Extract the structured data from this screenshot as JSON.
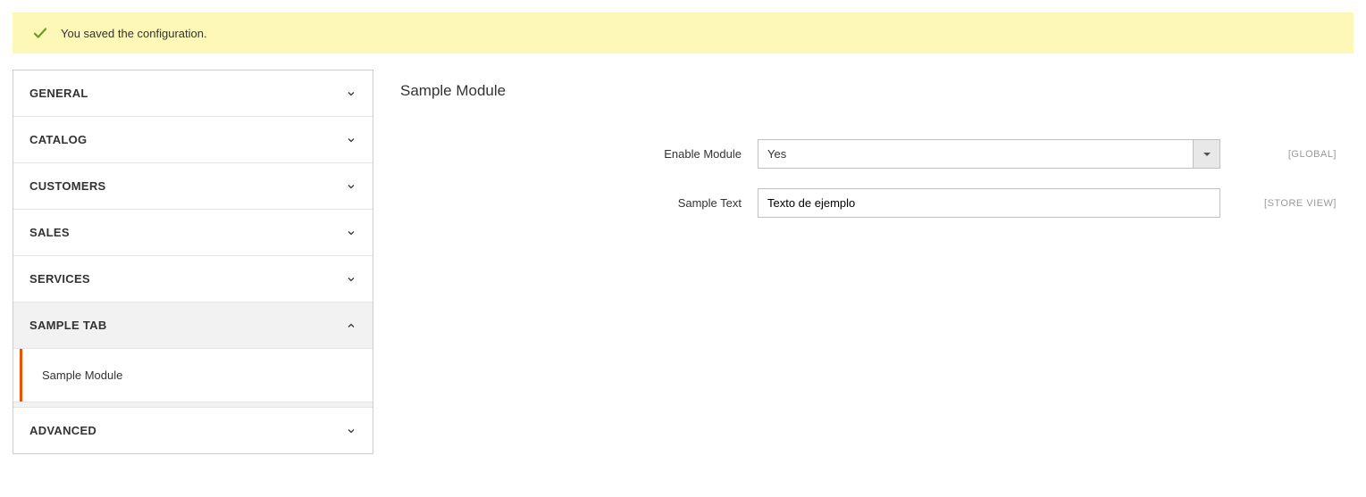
{
  "notification": {
    "message": "You saved the configuration."
  },
  "sidebar": {
    "items": [
      {
        "label": "GENERAL",
        "expanded": false
      },
      {
        "label": "CATALOG",
        "expanded": false
      },
      {
        "label": "CUSTOMERS",
        "expanded": false
      },
      {
        "label": "SALES",
        "expanded": false
      },
      {
        "label": "SERVICES",
        "expanded": false
      },
      {
        "label": "SAMPLE TAB",
        "expanded": true,
        "sub": {
          "label": "Sample Module"
        }
      },
      {
        "label": "ADVANCED",
        "expanded": false
      }
    ]
  },
  "section": {
    "title": "Sample Module"
  },
  "form": {
    "enable": {
      "label": "Enable Module",
      "value": "Yes",
      "scope": "[GLOBAL]"
    },
    "text": {
      "label": "Sample Text",
      "value": "Texto de ejemplo",
      "scope": "[STORE VIEW]"
    }
  }
}
